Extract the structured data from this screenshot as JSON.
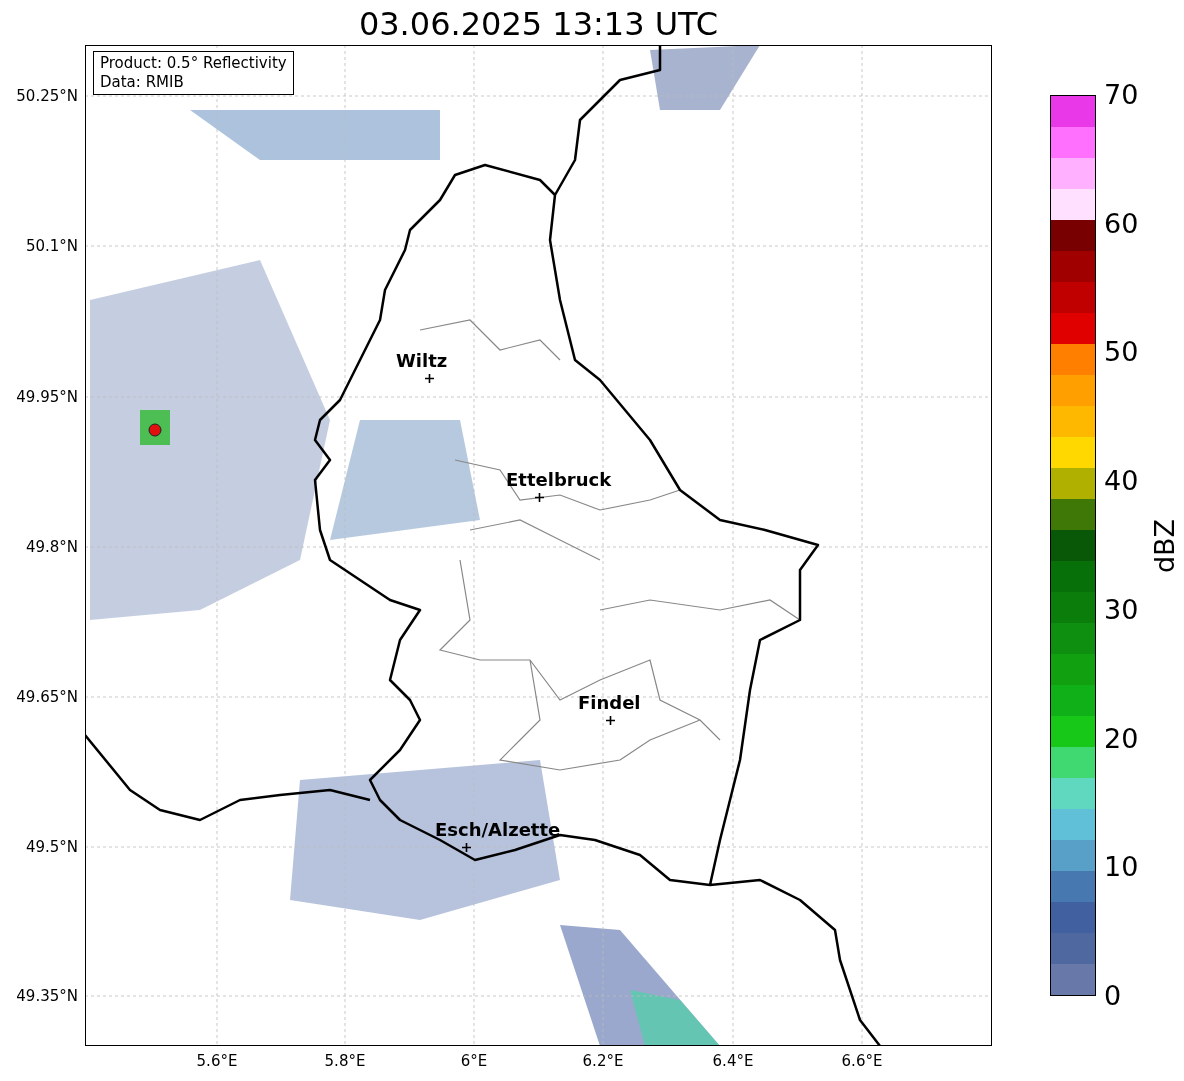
{
  "title": "03.06.2025 13:13 UTC",
  "info_box": {
    "lines": [
      "Product: 0.5° Reflectivity",
      "Data: RMIB"
    ]
  },
  "cities": [
    {
      "name": "Wiltz"
    },
    {
      "name": "Ettelbruck"
    },
    {
      "name": "Findel"
    },
    {
      "name": "Esch/Alzette"
    }
  ],
  "lat_ticks": [
    "50.25°N",
    "50.1°N",
    "49.95°N",
    "49.8°N",
    "49.65°N",
    "49.5°N",
    "49.35°N"
  ],
  "lon_ticks": [
    "5.6°E",
    "5.8°E",
    "6°E",
    "6.2°E",
    "6.4°E",
    "6.6°E"
  ],
  "colorbar": {
    "label": "dBZ",
    "ticks": [
      "70",
      "60",
      "50",
      "40",
      "30",
      "20",
      "10",
      "0"
    ],
    "segments": [
      {
        "color": "#e838e8"
      },
      {
        "color": "#ff70ff"
      },
      {
        "color": "#ffb0ff"
      },
      {
        "color": "#ffe0ff"
      },
      {
        "color": "#780000"
      },
      {
        "color": "#a00000"
      },
      {
        "color": "#c00000"
      },
      {
        "color": "#e00000"
      },
      {
        "color": "#ff8000"
      },
      {
        "color": "#ffa000"
      },
      {
        "color": "#ffb800"
      },
      {
        "color": "#ffd800"
      },
      {
        "color": "#b0b000"
      },
      {
        "color": "#407808"
      },
      {
        "color": "#085808"
      },
      {
        "color": "#087008"
      },
      {
        "color": "#0a7d0a"
      },
      {
        "color": "#0f8f0f"
      },
      {
        "color": "#10a010"
      },
      {
        "color": "#10b018"
      },
      {
        "color": "#18c818"
      },
      {
        "color": "#40d870"
      },
      {
        "color": "#60d8c0"
      },
      {
        "color": "#60c0d8"
      },
      {
        "color": "#58a0c8"
      },
      {
        "color": "#4878b0"
      },
      {
        "color": "#4060a0"
      },
      {
        "color": "#5068a0"
      },
      {
        "color": "#6878a8"
      }
    ]
  }
}
